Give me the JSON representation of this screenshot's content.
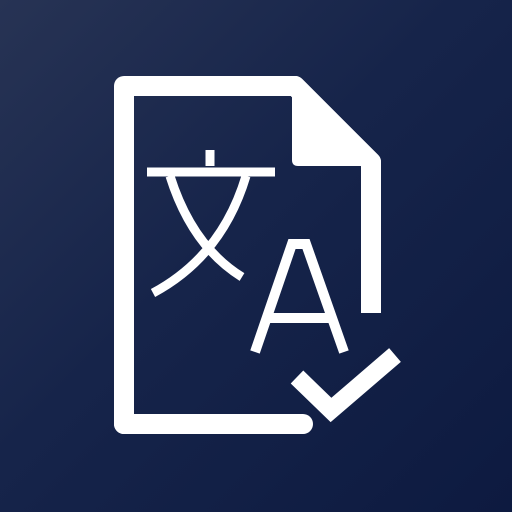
{
  "app_icon": {
    "name": "translate-document-icon",
    "background_color": "#131f45",
    "background_gradient": [
      "#273354",
      "#0d1a40"
    ],
    "glyph_color": "#ffffff",
    "glyphs": {
      "chinese_character": "文",
      "latin_letter": "A"
    },
    "icons": [
      "document-icon",
      "chinese-character-glyph",
      "letter-a-glyph",
      "checkmark-icon"
    ]
  }
}
